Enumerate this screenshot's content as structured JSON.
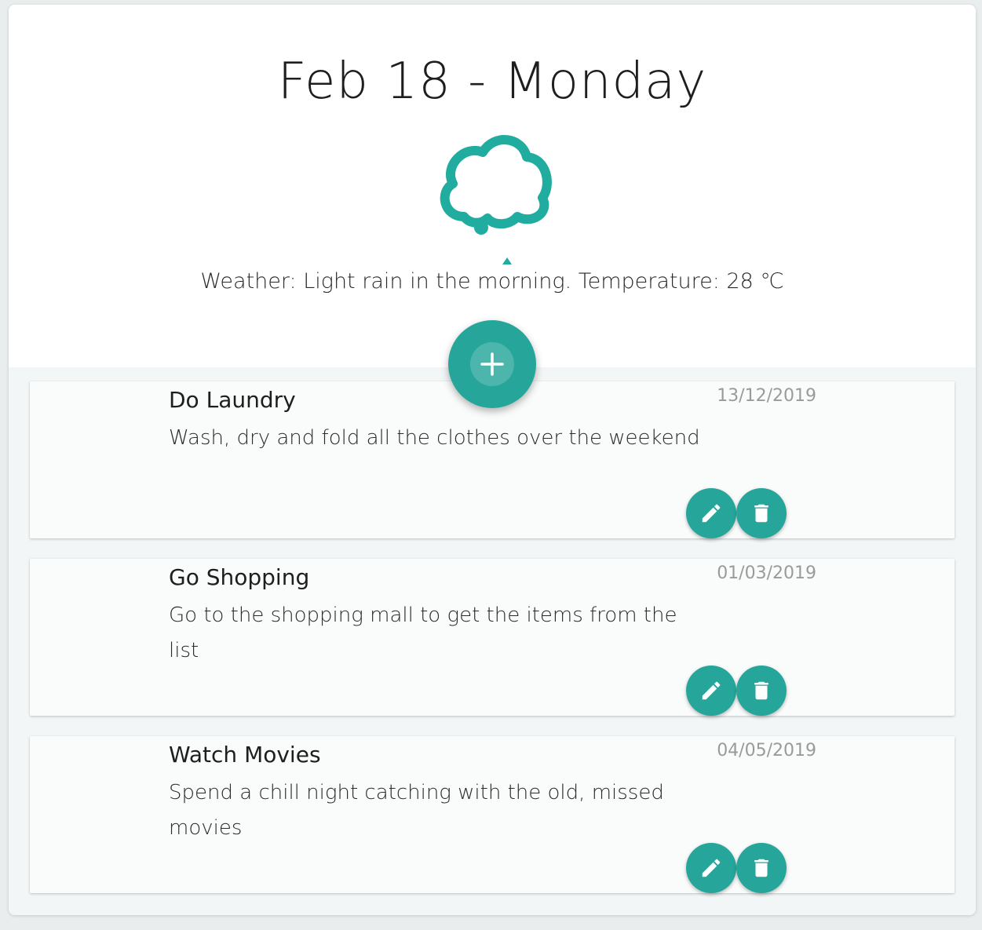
{
  "header": {
    "date_title": "Feb 18 - Monday",
    "weather_icon": "cloud-icon",
    "weather_text": "Weather: Light rain in the morning. Temperature: 28 ℃"
  },
  "add_button": {
    "icon": "plus-icon"
  },
  "tasks": [
    {
      "title": "Do Laundry",
      "description": "Wash, dry and fold all the clothes over the weekend",
      "date": "13/12/2019"
    },
    {
      "title": "Go Shopping",
      "description": "Go to the shopping mall to get the items from the list",
      "date": "01/03/2019"
    },
    {
      "title": "Watch Movies",
      "description": "Spend a chill night catching with the old, missed movies",
      "date": "04/05/2019"
    }
  ],
  "colors": {
    "accent": "#26a69a",
    "page_background": "#e9eded",
    "list_background": "#f3f6f7",
    "card_background": "#fafbfb",
    "date_text": "#9a9a9a"
  },
  "icons": {
    "edit": "pencil-icon",
    "delete": "trash-icon"
  }
}
